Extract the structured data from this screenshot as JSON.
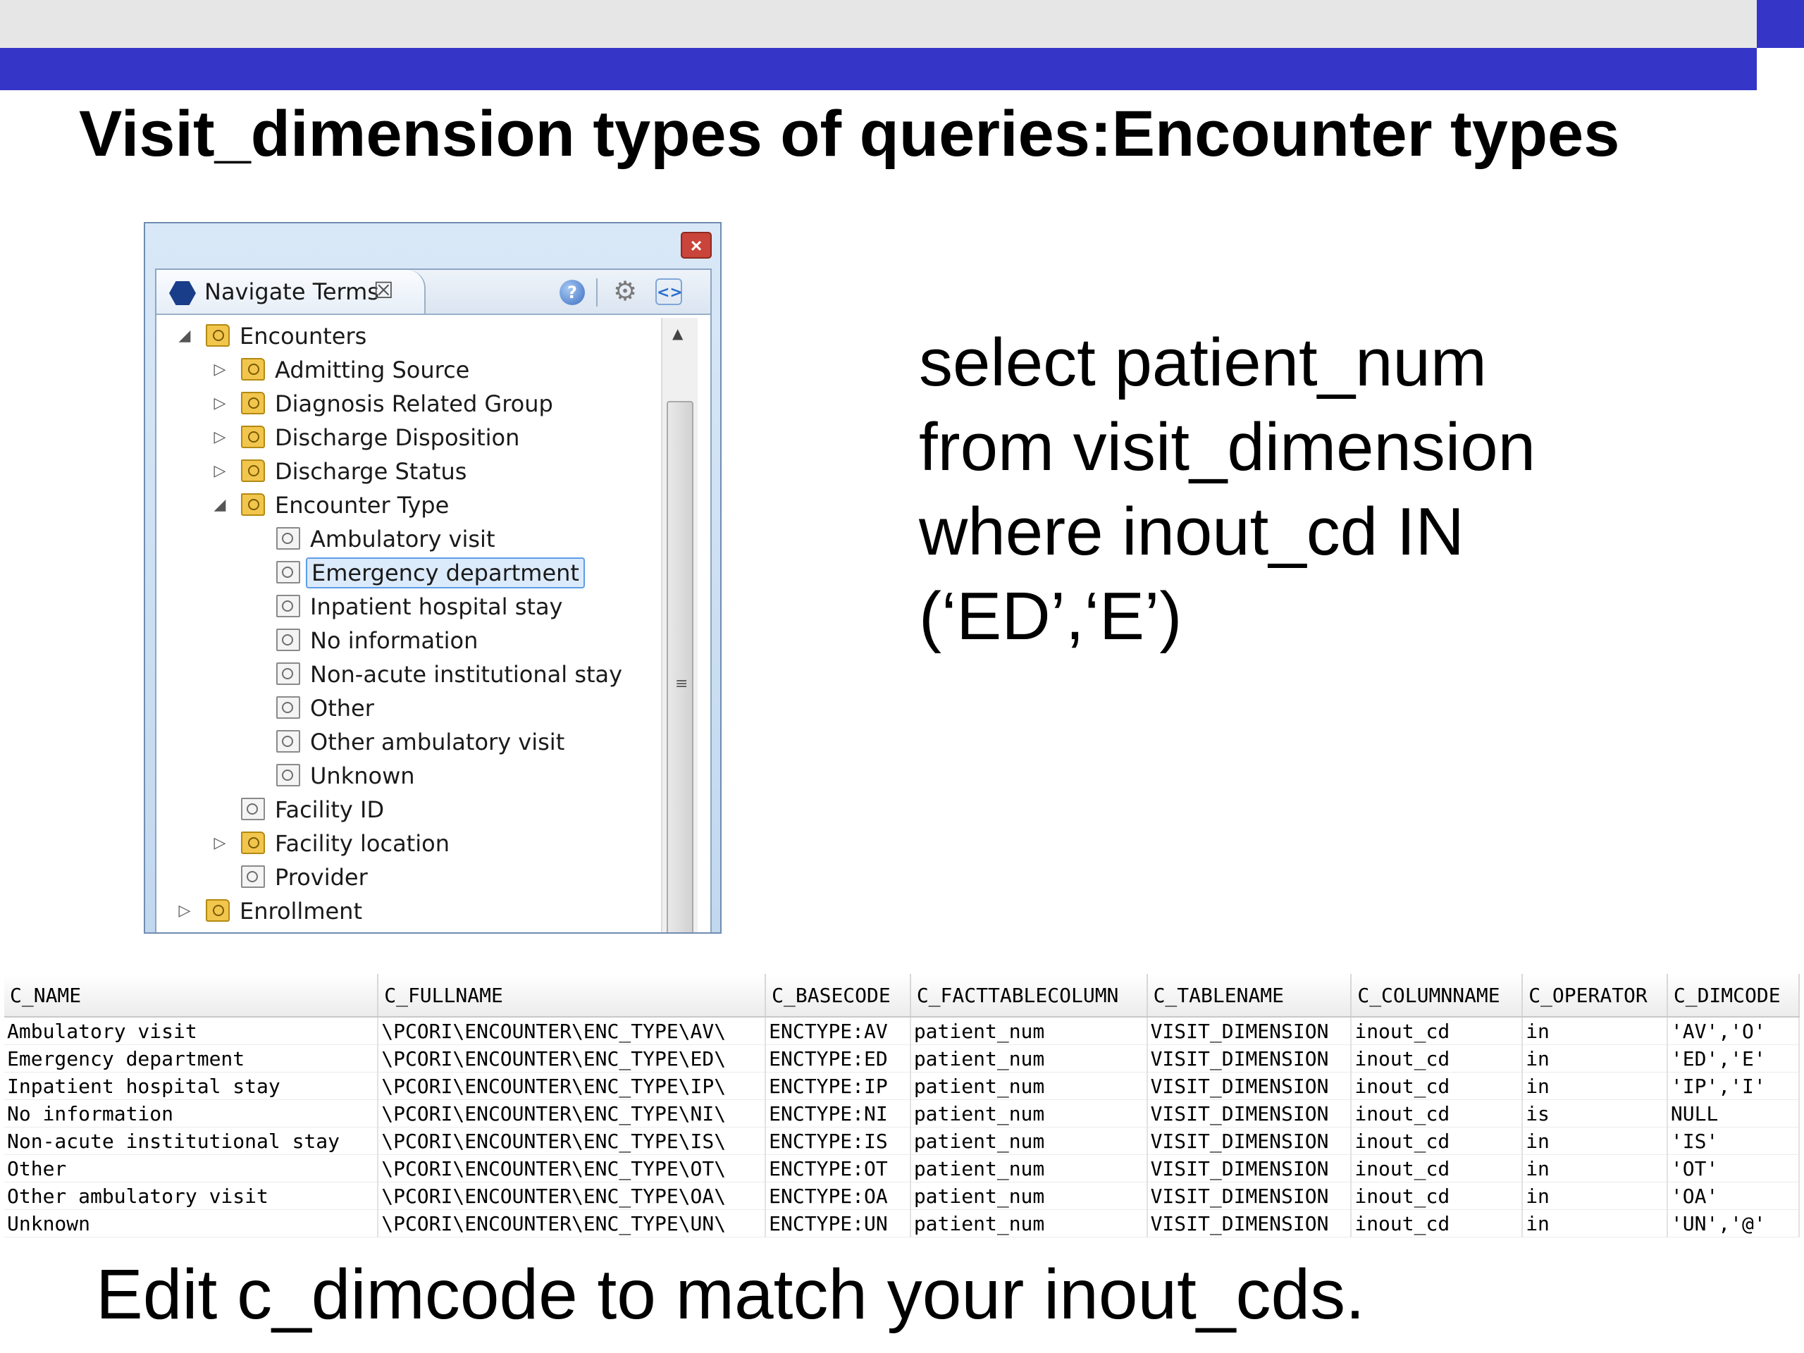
{
  "slide": {
    "title": "Visit_dimension types of queries:Encounter types",
    "footer": "Edit c_dimcode to match your inout_cds."
  },
  "colors": {
    "accent_blue": "#3535c8",
    "top_gray": "#e6e6e6",
    "selection": "#dcebfb"
  },
  "window": {
    "close_glyph": "×"
  },
  "navigate_panel": {
    "tab_label": "Navigate Terms",
    "tab_close_glyph": "☒",
    "help_glyph": "?",
    "gear_glyph": "⚙",
    "sync_glyph": "<>",
    "scroll_up_glyph": "▲",
    "thumb_grip_glyph": "≡",
    "tree": [
      {
        "label": "Encounters",
        "depth": 0,
        "icon": "folder-icon",
        "expander": "◢",
        "selected": false
      },
      {
        "label": "Admitting Source",
        "depth": 1,
        "icon": "folder-icon",
        "expander": "▷",
        "selected": false
      },
      {
        "label": "Diagnosis Related Group",
        "depth": 1,
        "icon": "folder-icon",
        "expander": "▷",
        "selected": false
      },
      {
        "label": "Discharge Disposition",
        "depth": 1,
        "icon": "folder-icon",
        "expander": "▷",
        "selected": false
      },
      {
        "label": "Discharge Status",
        "depth": 1,
        "icon": "folder-icon",
        "expander": "▷",
        "selected": false
      },
      {
        "label": "Encounter Type",
        "depth": 1,
        "icon": "folder-icon",
        "expander": "◢",
        "selected": false
      },
      {
        "label": "Ambulatory visit",
        "depth": 2,
        "icon": "term-icon",
        "expander": "",
        "selected": false
      },
      {
        "label": "Emergency department",
        "depth": 2,
        "icon": "term-icon",
        "expander": "",
        "selected": true
      },
      {
        "label": "Inpatient hospital stay",
        "depth": 2,
        "icon": "term-icon",
        "expander": "",
        "selected": false
      },
      {
        "label": "No information",
        "depth": 2,
        "icon": "term-icon",
        "expander": "",
        "selected": false
      },
      {
        "label": "Non-acute institutional stay",
        "depth": 2,
        "icon": "term-icon",
        "expander": "",
        "selected": false
      },
      {
        "label": "Other",
        "depth": 2,
        "icon": "term-icon",
        "expander": "",
        "selected": false
      },
      {
        "label": "Other ambulatory visit",
        "depth": 2,
        "icon": "term-icon",
        "expander": "",
        "selected": false
      },
      {
        "label": "Unknown",
        "depth": 2,
        "icon": "term-icon",
        "expander": "",
        "selected": false
      },
      {
        "label": "Facility ID",
        "depth": 1,
        "icon": "term-icon",
        "expander": "",
        "selected": false
      },
      {
        "label": "Facility location",
        "depth": 1,
        "icon": "folder-icon",
        "expander": "▷",
        "selected": false
      },
      {
        "label": "Provider",
        "depth": 1,
        "icon": "term-icon",
        "expander": "",
        "selected": false
      },
      {
        "label": "Enrollment",
        "depth": 0,
        "icon": "folder-icon",
        "expander": "▷",
        "selected": false
      }
    ]
  },
  "sql": {
    "lines": [
      "select patient_num",
      "from visit_dimension",
      "where inout_cd IN",
      "(‘ED’,‘E’)"
    ]
  },
  "table": {
    "columns": [
      "C_NAME",
      "C_FULLNAME",
      "C_BASECODE",
      "C_FACTTABLECOLUMN",
      "C_TABLENAME",
      "C_COLUMNNAME",
      "C_OPERATOR",
      "C_DIMCODE"
    ],
    "rows": [
      [
        "Ambulatory visit",
        "\\PCORI\\ENCOUNTER\\ENC_TYPE\\AV\\",
        "ENCTYPE:AV",
        "patient_num",
        "VISIT_DIMENSION",
        "inout_cd",
        "in",
        "'AV','O'"
      ],
      [
        "Emergency department",
        "\\PCORI\\ENCOUNTER\\ENC_TYPE\\ED\\",
        "ENCTYPE:ED",
        "patient_num",
        "VISIT_DIMENSION",
        "inout_cd",
        "in",
        "'ED','E'"
      ],
      [
        "Inpatient hospital stay",
        "\\PCORI\\ENCOUNTER\\ENC_TYPE\\IP\\",
        "ENCTYPE:IP",
        "patient_num",
        "VISIT_DIMENSION",
        "inout_cd",
        "in",
        "'IP','I'"
      ],
      [
        "No information",
        "\\PCORI\\ENCOUNTER\\ENC_TYPE\\NI\\",
        "ENCTYPE:NI",
        "patient_num",
        "VISIT_DIMENSION",
        "inout_cd",
        "is",
        "NULL"
      ],
      [
        "Non-acute institutional stay",
        "\\PCORI\\ENCOUNTER\\ENC_TYPE\\IS\\",
        "ENCTYPE:IS",
        "patient_num",
        "VISIT_DIMENSION",
        "inout_cd",
        "in",
        "'IS'"
      ],
      [
        "Other",
        "\\PCORI\\ENCOUNTER\\ENC_TYPE\\OT\\",
        "ENCTYPE:OT",
        "patient_num",
        "VISIT_DIMENSION",
        "inout_cd",
        "in",
        "'OT'"
      ],
      [
        "Other ambulatory visit",
        "\\PCORI\\ENCOUNTER\\ENC_TYPE\\OA\\",
        "ENCTYPE:OA",
        "patient_num",
        "VISIT_DIMENSION",
        "inout_cd",
        "in",
        "'OA'"
      ],
      [
        "Unknown",
        "\\PCORI\\ENCOUNTER\\ENC_TYPE\\UN\\",
        "ENCTYPE:UN",
        "patient_num",
        "VISIT_DIMENSION",
        "inout_cd",
        "in",
        "'UN','@'"
      ]
    ]
  }
}
